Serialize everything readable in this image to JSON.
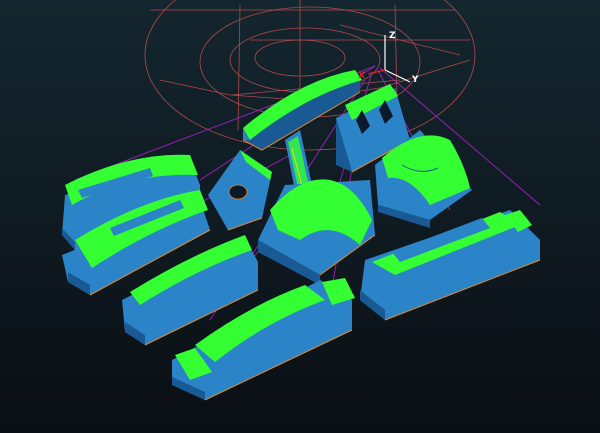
{
  "viewport": {
    "background_top": "#14262f",
    "background_bottom": "#0a0f14",
    "toolpath_color": "#b04a4a",
    "rapid_color": "#a020c0",
    "part_color": "#2b84c8",
    "part_shadow": "#1a5a94",
    "machined_surface_color": "#33ff33",
    "edge_color": "#e08a2a"
  },
  "triad": {
    "x_label": "X",
    "y_label": "Y",
    "z_label": "Z",
    "x_color": "#e02020",
    "y_color": "#ffffff",
    "z_color": "#ffffff"
  },
  "parts": [
    {
      "name": "arched-bar-part"
    },
    {
      "name": "center-pyramid-part"
    },
    {
      "name": "left-bar-part"
    },
    {
      "name": "left-curved-bar-part"
    },
    {
      "name": "hole-block-part"
    },
    {
      "name": "center-saddle-part"
    },
    {
      "name": "right-saddle-part"
    },
    {
      "name": "right-bar-part"
    },
    {
      "name": "long-slanted-bar-part"
    },
    {
      "name": "front-bar-part"
    }
  ]
}
